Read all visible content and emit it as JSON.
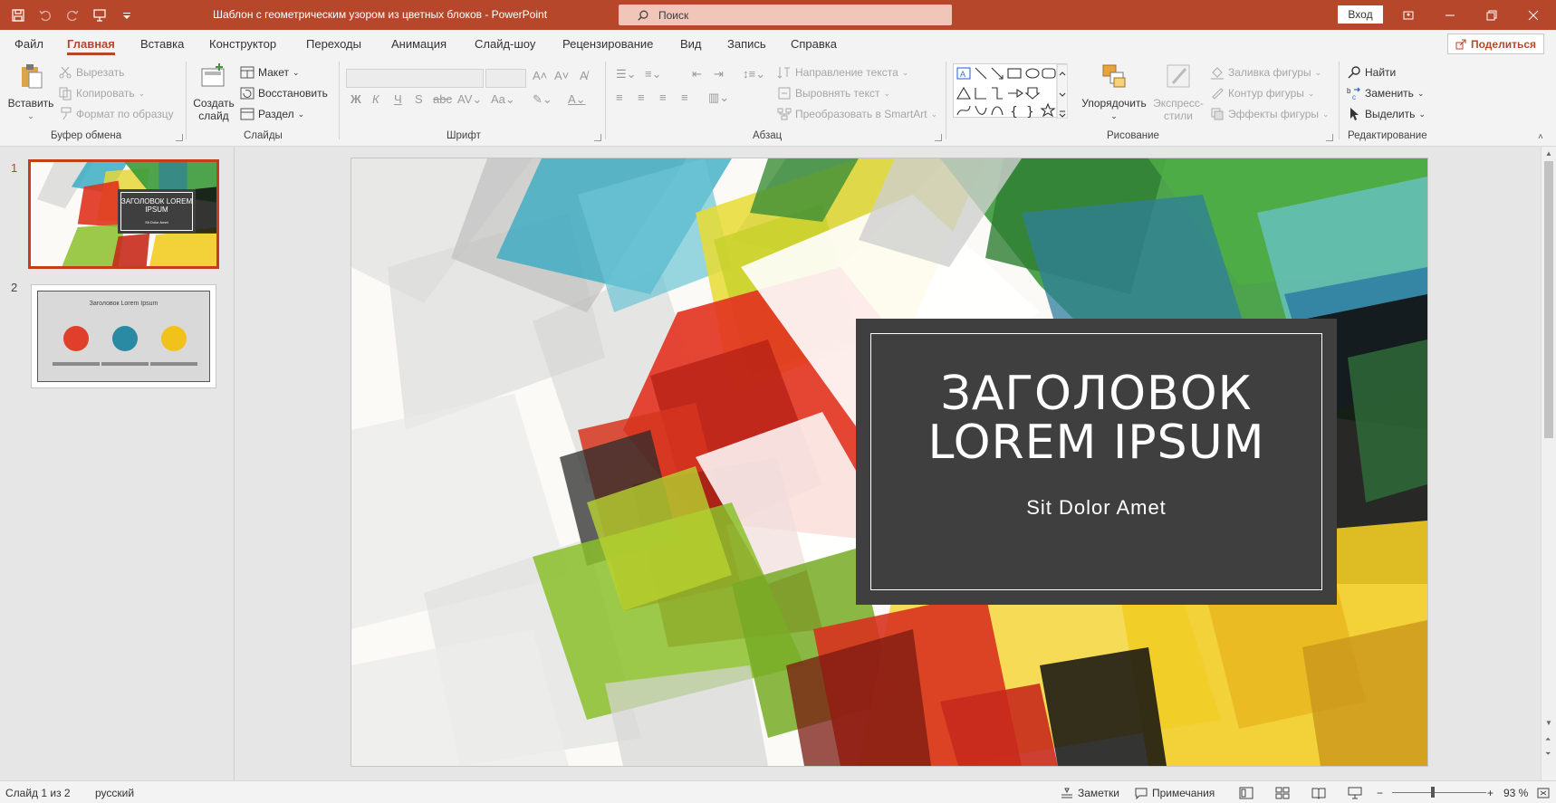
{
  "titlebar": {
    "doc_title": "Шаблон с геометрическим узором из цветных блоков  -  PowerPoint",
    "search_placeholder": "Поиск",
    "signin": "Вход"
  },
  "menu": {
    "tabs": [
      "Файл",
      "Главная",
      "Вставка",
      "Конструктор",
      "Переходы",
      "Анимация",
      "Слайд-шоу",
      "Рецензирование",
      "Вид",
      "Запись",
      "Справка"
    ],
    "active": "Главная",
    "share": "Поделиться"
  },
  "ribbon": {
    "clipboard": {
      "label": "Буфер обмена",
      "paste": "Вставить",
      "cut": "Вырезать",
      "copy": "Копировать",
      "format_painter": "Формат по образцу"
    },
    "slides": {
      "label": "Слайды",
      "new_slide_1": "Создать",
      "new_slide_2": "слайд",
      "layout": "Макет",
      "reset": "Восстановить",
      "section": "Раздел"
    },
    "font": {
      "label": "Шрифт"
    },
    "paragraph": {
      "label": "Абзац",
      "text_direction": "Направление текста",
      "align_text": "Выровнять текст",
      "smartart": "Преобразовать в SmartArt"
    },
    "drawing": {
      "label": "Рисование",
      "arrange": "Упорядочить",
      "quick_styles_1": "Экспресс-",
      "quick_styles_2": "стили",
      "shape_fill": "Заливка фигуры",
      "shape_outline": "Контур фигуры",
      "shape_effects": "Эффекты фигуры"
    },
    "editing": {
      "label": "Редактирование",
      "find": "Найти",
      "replace": "Заменить",
      "select": "Выделить"
    }
  },
  "thumbnails": [
    {
      "number": "1",
      "title": "ЗАГОЛОВОК LOREM IPSUM",
      "subtitle": "Sit Dolor Amet"
    },
    {
      "number": "2",
      "title": "Заголовок Lorem Ipsum"
    }
  ],
  "slide": {
    "title_line1": "ЗАГОЛОВОК",
    "title_line2": "LOREM IPSUM",
    "subtitle": "Sit Dolor Amet"
  },
  "status": {
    "slide_counter": "Слайд 1 из 2",
    "language": "русский",
    "notes": "Заметки",
    "comments": "Примечания",
    "zoom": "93 %"
  },
  "colors": {
    "accent": "#b7472a",
    "selection": "#c43e1c",
    "title_box": "#3f3f3f"
  }
}
